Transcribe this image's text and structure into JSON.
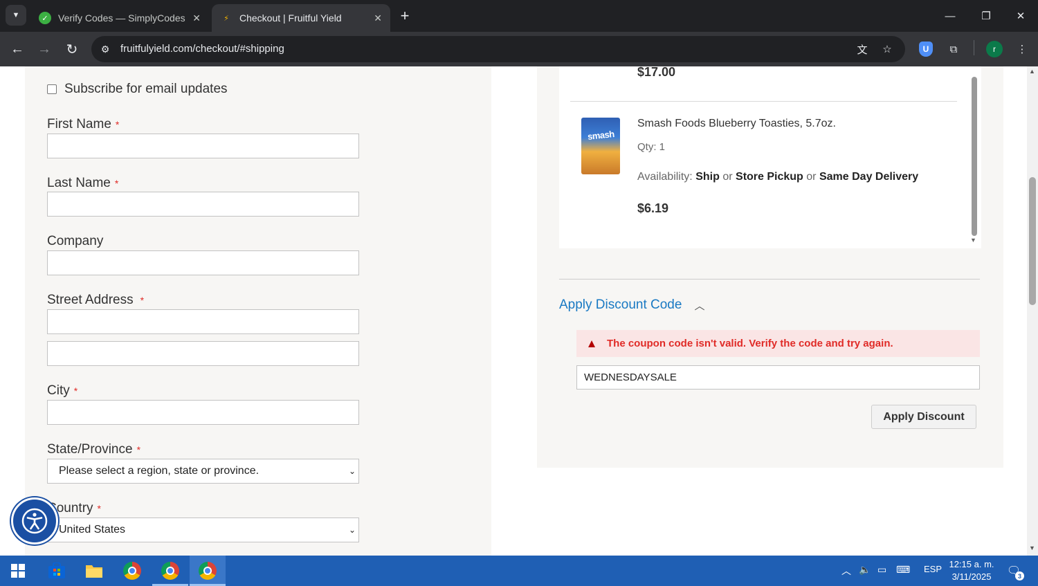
{
  "browser": {
    "tabs": [
      {
        "title": "Verify Codes — SimplyCodes",
        "favicon": "simplycodes-icon",
        "active": false
      },
      {
        "title": "Checkout | Fruitful Yield",
        "favicon": "fruitful-yield-icon",
        "active": true
      }
    ],
    "url": "fruitfulyield.com/checkout/#shipping",
    "profile_initial": "r",
    "extension_badge": "U"
  },
  "form": {
    "subscribe_label": "Subscribe for email updates",
    "first_name_label": "First Name",
    "last_name_label": "Last Name",
    "company_label": "Company",
    "street_label": "Street Address",
    "city_label": "City",
    "state_label": "State/Province",
    "state_value": "Please select a region, state or province.",
    "country_label": "Country",
    "country_value": "United States",
    "required_mark": "*"
  },
  "summary": {
    "previous_item_price": "$17.00",
    "item": {
      "image_label": "smash",
      "name": "Smash Foods Blueberry Toasties, 5.7oz.",
      "qty": "Qty: 1",
      "availability_label": "Availability:",
      "avail_ship": "Ship",
      "avail_or": "or",
      "avail_pickup": "Store Pickup",
      "avail_sameday": "Same Day Delivery",
      "price": "$6.19"
    },
    "discount": {
      "toggle_label": "Apply Discount Code",
      "error_message": "The coupon code isn't valid. Verify the code and try again.",
      "code_value": "WEDNESDAYSALE",
      "apply_button": "Apply Discount"
    }
  },
  "taskbar": {
    "language": "ESP",
    "time": "12:15 a. m.",
    "date": "3/11/2025",
    "notification_count": "3"
  }
}
